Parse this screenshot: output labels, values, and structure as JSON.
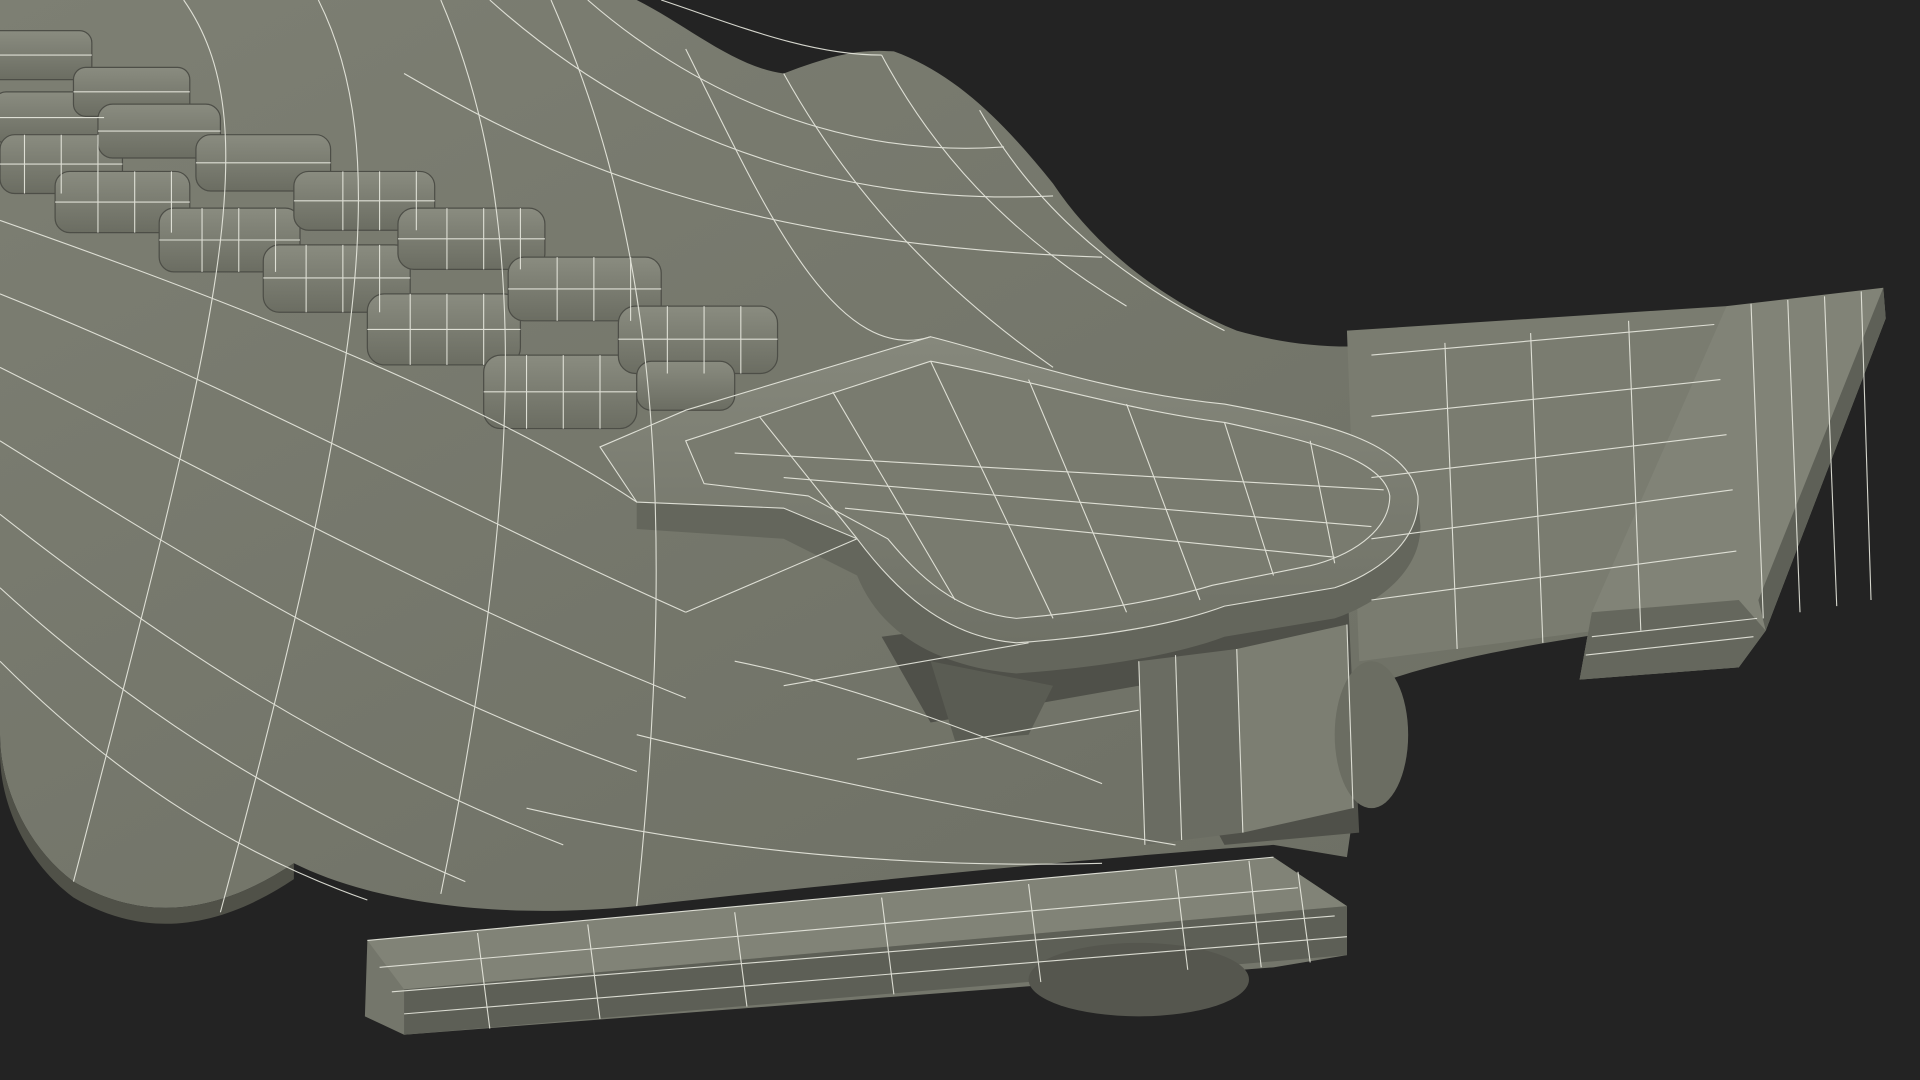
{
  "scene": {
    "subject": "zipper-slider-wireframe-render",
    "colors": {
      "background": "#232323",
      "surface": "#7b7d71",
      "surface_dark": "#5f6158",
      "surface_light": "#8c8e82",
      "shadow": "#3e3f39",
      "wire": "#e9eae0"
    }
  }
}
